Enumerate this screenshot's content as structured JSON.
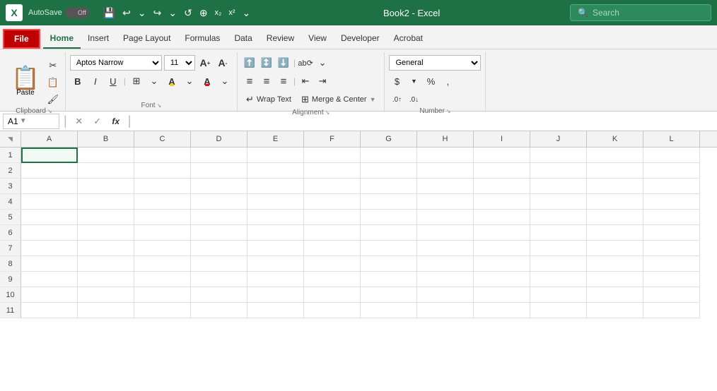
{
  "titleBar": {
    "appIcon": "X",
    "autoSave": "AutoSave",
    "toggleState": "Off",
    "saveIcon": "💾",
    "undoIcon": "↩",
    "redoIcon": "↪",
    "refreshIcon": "↺",
    "crosshairIcon": "⊕",
    "subscriptIcon": "x₂",
    "superscriptIcon": "x²",
    "moreIcon": "⌄",
    "title": "Book2 - Excel",
    "searchPlaceholder": "Search"
  },
  "ribbon": {
    "tabs": [
      "File",
      "Home",
      "Insert",
      "Page Layout",
      "Formulas",
      "Data",
      "Review",
      "View",
      "Developer",
      "Acrobat"
    ],
    "activeTab": "Home",
    "groups": {
      "clipboard": {
        "label": "Clipboard",
        "paste": "Paste",
        "cut": "✂",
        "copy": "📋",
        "formatPainter": "🖌"
      },
      "font": {
        "label": "Font",
        "fontName": "Aptos Narrow",
        "fontSize": "11",
        "increaseFont": "A",
        "decreaseFont": "A",
        "bold": "B",
        "italic": "I",
        "underline": "U",
        "borders": "⊞",
        "fillColor": "A",
        "fontColor": "A"
      },
      "alignment": {
        "label": "Alignment",
        "alignTop": "≡",
        "alignMiddle": "≡",
        "alignBottom": "≡",
        "alignLeft": "≡",
        "alignCenter": "≡",
        "alignRight": "≡",
        "wrapText": "Wrap Text",
        "mergeCenter": "Merge & Center",
        "indent": "⇥",
        "outdent": "⇤",
        "orientation": "ab"
      },
      "number": {
        "label": "Number",
        "format": "General",
        "currency": "$",
        "percent": "%",
        "comma": ",",
        "increaseDecimal": ".00",
        "decreaseDecimal": ".0"
      }
    }
  },
  "formulaBar": {
    "cellRef": "A1",
    "cancelIcon": "✕",
    "confirmIcon": "✓",
    "formulaIcon": "fx",
    "content": ""
  },
  "spreadsheet": {
    "columns": [
      "A",
      "B",
      "C",
      "D",
      "E",
      "F",
      "G",
      "H",
      "I",
      "J",
      "K",
      "L"
    ],
    "rows": [
      1,
      2,
      3,
      4,
      5,
      6,
      7,
      8,
      9,
      10,
      11
    ],
    "selectedCell": "A1"
  }
}
